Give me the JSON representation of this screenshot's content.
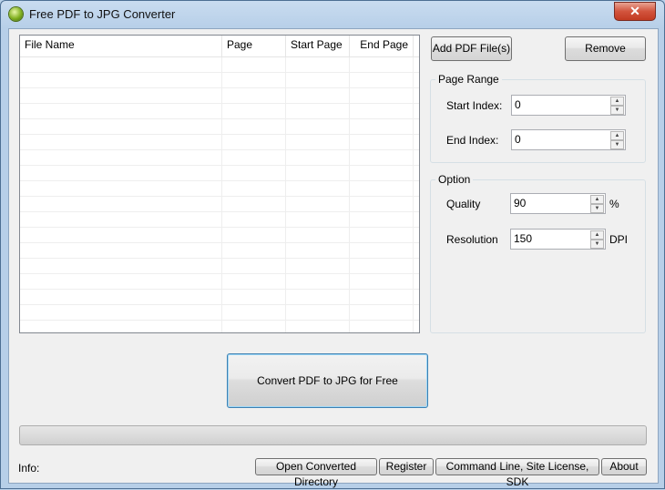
{
  "window": {
    "title": "Free PDF to JPG Converter",
    "close_glyph": "✕"
  },
  "file_list": {
    "columns": [
      "File Name",
      "Page Count",
      "Start Page",
      "End Page"
    ],
    "rows": []
  },
  "buttons": {
    "add_files": "Add PDF File(s)",
    "remove": "Remove",
    "convert": "Convert PDF to JPG for Free"
  },
  "page_range": {
    "group_label": "Page Range",
    "start_label": "Start Index:",
    "start_value": "0",
    "end_label": "End Index:",
    "end_value": "0"
  },
  "option": {
    "group_label": "Option",
    "quality_label": "Quality",
    "quality_value": "90",
    "quality_unit": "%",
    "resolution_label": "Resolution",
    "resolution_value": "150",
    "resolution_unit": "DPI"
  },
  "progress": {
    "value": 0
  },
  "footer": {
    "info_label": "Info:",
    "open_dir": "Open Converted Directory",
    "register": "Register",
    "cmdline": "Command Line, Site License, SDK",
    "about": "About"
  },
  "icons": {
    "spin_up": "▲",
    "spin_down": "▼"
  }
}
